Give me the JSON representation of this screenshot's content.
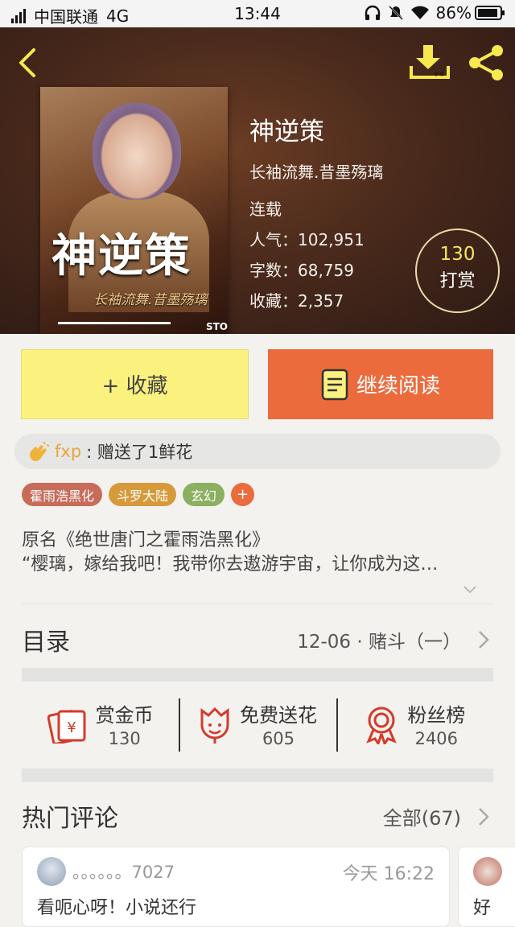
{
  "status": {
    "carrier": "中国联通",
    "network": "4G",
    "time": "13:44",
    "battery": "86%"
  },
  "book": {
    "title": "神逆策",
    "author": "长袖流舞.昔墨殇璃",
    "state": "连载",
    "popularity": "人气：102,951",
    "words": "字数：68,759",
    "favorites": "收藏：2,357",
    "cover_title": "神逆策",
    "cover_author": "长袖流舞.昔墨殇璃",
    "cover_pub": "STO"
  },
  "tip": {
    "count": "130",
    "label": "打赏"
  },
  "actions": {
    "favorite": "+ 收藏",
    "read": "继续阅读"
  },
  "gift": {
    "user": "fxp",
    "text": ": 赠送了1鲜花"
  },
  "tags": [
    {
      "label": "霍雨浩黑化",
      "color": "#c86c5a"
    },
    {
      "label": "斗罗大陆",
      "color": "#d79a3a"
    },
    {
      "label": "玄幻",
      "color": "#8ab060"
    },
    {
      "label": "+",
      "color": "#ec6b3d"
    }
  ],
  "description": {
    "line1": "原名《绝世唐门之霍雨浩黑化》",
    "line2": "“樱璃，嫁给我吧！我带你去遨游宇宙，让你成为这…"
  },
  "toc": {
    "title": "目录",
    "latest": "12-06 · 赌斗（一）"
  },
  "stats": [
    {
      "label": "赏金币",
      "value": "130",
      "icon": "red-envelope-icon"
    },
    {
      "label": "免费送花",
      "value": "605",
      "icon": "flower-icon"
    },
    {
      "label": "粉丝榜",
      "value": "2406",
      "icon": "award-ribbon-icon"
    }
  ],
  "comments": {
    "title": "热门评论",
    "all": "全部(67)",
    "items": [
      {
        "user": "。。。。。。7027",
        "time": "今天 16:22",
        "text": "看呃心呀！小说还行"
      },
      {
        "text": "好"
      }
    ]
  },
  "colors": {
    "accent": "#ec6b3d",
    "favorite_bg": "#fbf17e",
    "tip_number": "#f7e65a",
    "icon_red": "#d33b2c"
  }
}
